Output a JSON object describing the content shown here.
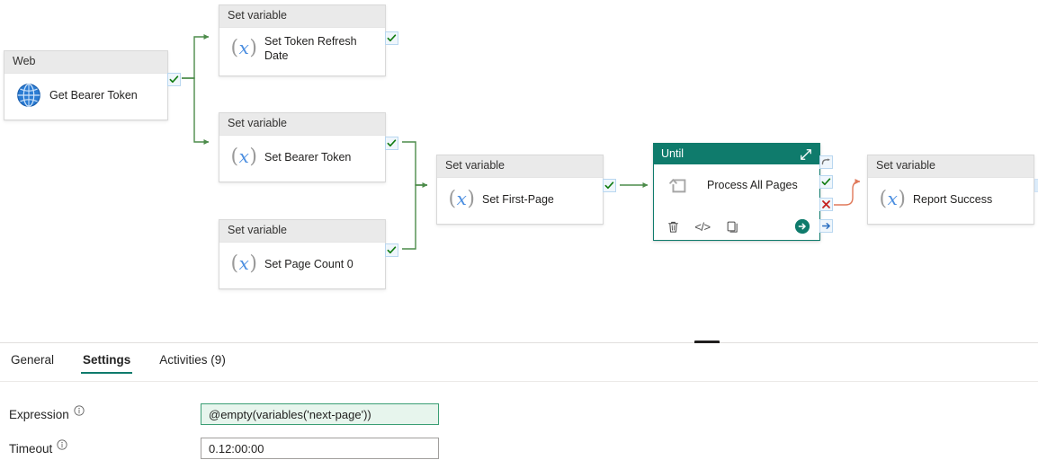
{
  "canvas": {
    "nodes": [
      {
        "id": "web-get-bearer-token",
        "type_label": "Web",
        "name": "Get Bearer Token",
        "icon": "globe-icon"
      },
      {
        "id": "set-token-refresh-date",
        "type_label": "Set variable",
        "name": "Set Token Refresh Date",
        "icon": "variable-x-icon"
      },
      {
        "id": "set-bearer-token",
        "type_label": "Set variable",
        "name": "Set Bearer Token",
        "icon": "variable-x-icon"
      },
      {
        "id": "set-page-count-0",
        "type_label": "Set variable",
        "name": "Set Page Count 0",
        "icon": "variable-x-icon"
      },
      {
        "id": "set-first-page",
        "type_label": "Set variable",
        "name": "Set First-Page",
        "icon": "variable-x-icon"
      },
      {
        "id": "report-success",
        "type_label": "Set variable",
        "name": "Report Success",
        "icon": "variable-x-icon"
      }
    ],
    "until": {
      "header_title": "Until",
      "name": "Process All Pages",
      "expand_icon": "expand-diagonal-icon",
      "activity_icon": "until-loop-icon",
      "toolbar": [
        {
          "icon": "trash-icon",
          "name": "delete-activity-button"
        },
        {
          "icon": "code-icon",
          "name": "view-code-button"
        },
        {
          "icon": "copy-icon",
          "name": "clone-activity-button"
        },
        {
          "icon": "run-arrow-icon",
          "name": "run-activity-button"
        }
      ],
      "connectors": [
        {
          "icon": "skip-arrow-icon",
          "name": "on-skip-connector"
        },
        {
          "icon": "check-icon",
          "name": "on-success-connector"
        },
        {
          "icon": "x-icon",
          "name": "on-failure-connector"
        },
        {
          "icon": "arrow-right-icon",
          "name": "on-completion-connector"
        }
      ]
    },
    "colors": {
      "selected_node": "#0f7b6c",
      "success_wire": "#4c8b4a",
      "failure_wire": "#e58a6f",
      "node_header": "#eaeaea",
      "variable_glyph": "#4b8ee0"
    }
  },
  "panel": {
    "tabs": [
      {
        "label": "General",
        "active": false
      },
      {
        "label": "Settings",
        "active": true
      },
      {
        "label": "Activities (9)",
        "active": false
      }
    ],
    "fields": [
      {
        "label": "Expression",
        "value": "@empty(variables('next-page'))",
        "style": "expression",
        "info_icon": "info-icon"
      },
      {
        "label": "Timeout",
        "value": "0.12:00:00",
        "style": "plain",
        "info_icon": "info-icon"
      }
    ]
  }
}
